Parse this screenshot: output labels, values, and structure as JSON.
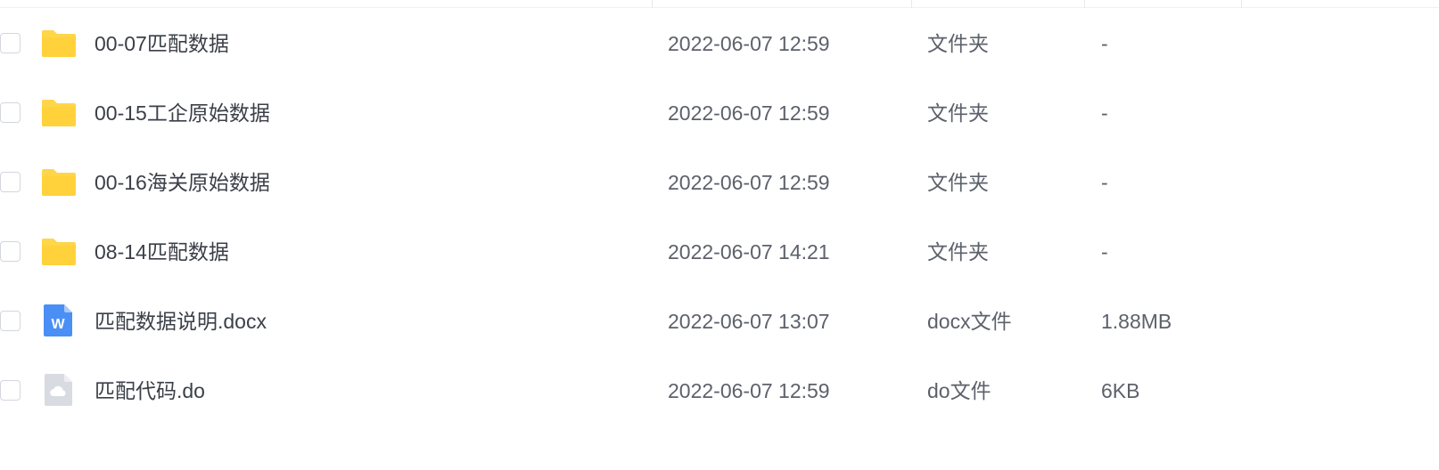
{
  "files": [
    {
      "name": "00-07匹配数据",
      "date": "2022-06-07 12:59",
      "type": "文件夹",
      "size": "-",
      "icon": "folder-icon"
    },
    {
      "name": "00-15工企原始数据",
      "date": "2022-06-07 12:59",
      "type": "文件夹",
      "size": "-",
      "icon": "folder-icon"
    },
    {
      "name": "00-16海关原始数据",
      "date": "2022-06-07 12:59",
      "type": "文件夹",
      "size": "-",
      "icon": "folder-icon"
    },
    {
      "name": "08-14匹配数据",
      "date": "2022-06-07 14:21",
      "type": "文件夹",
      "size": "-",
      "icon": "folder-icon"
    },
    {
      "name": "匹配数据说明.docx",
      "date": "2022-06-07 13:07",
      "type": "docx文件",
      "size": "1.88MB",
      "icon": "word-document-icon",
      "icon_letter": "W"
    },
    {
      "name": "匹配代码.do",
      "date": "2022-06-07 12:59",
      "type": "do文件",
      "size": "6KB",
      "icon": "generic-file-icon"
    }
  ],
  "colors": {
    "folder": "#ffd54a",
    "word": "#4a8ff5",
    "generic_file": "#d8dbe1"
  }
}
